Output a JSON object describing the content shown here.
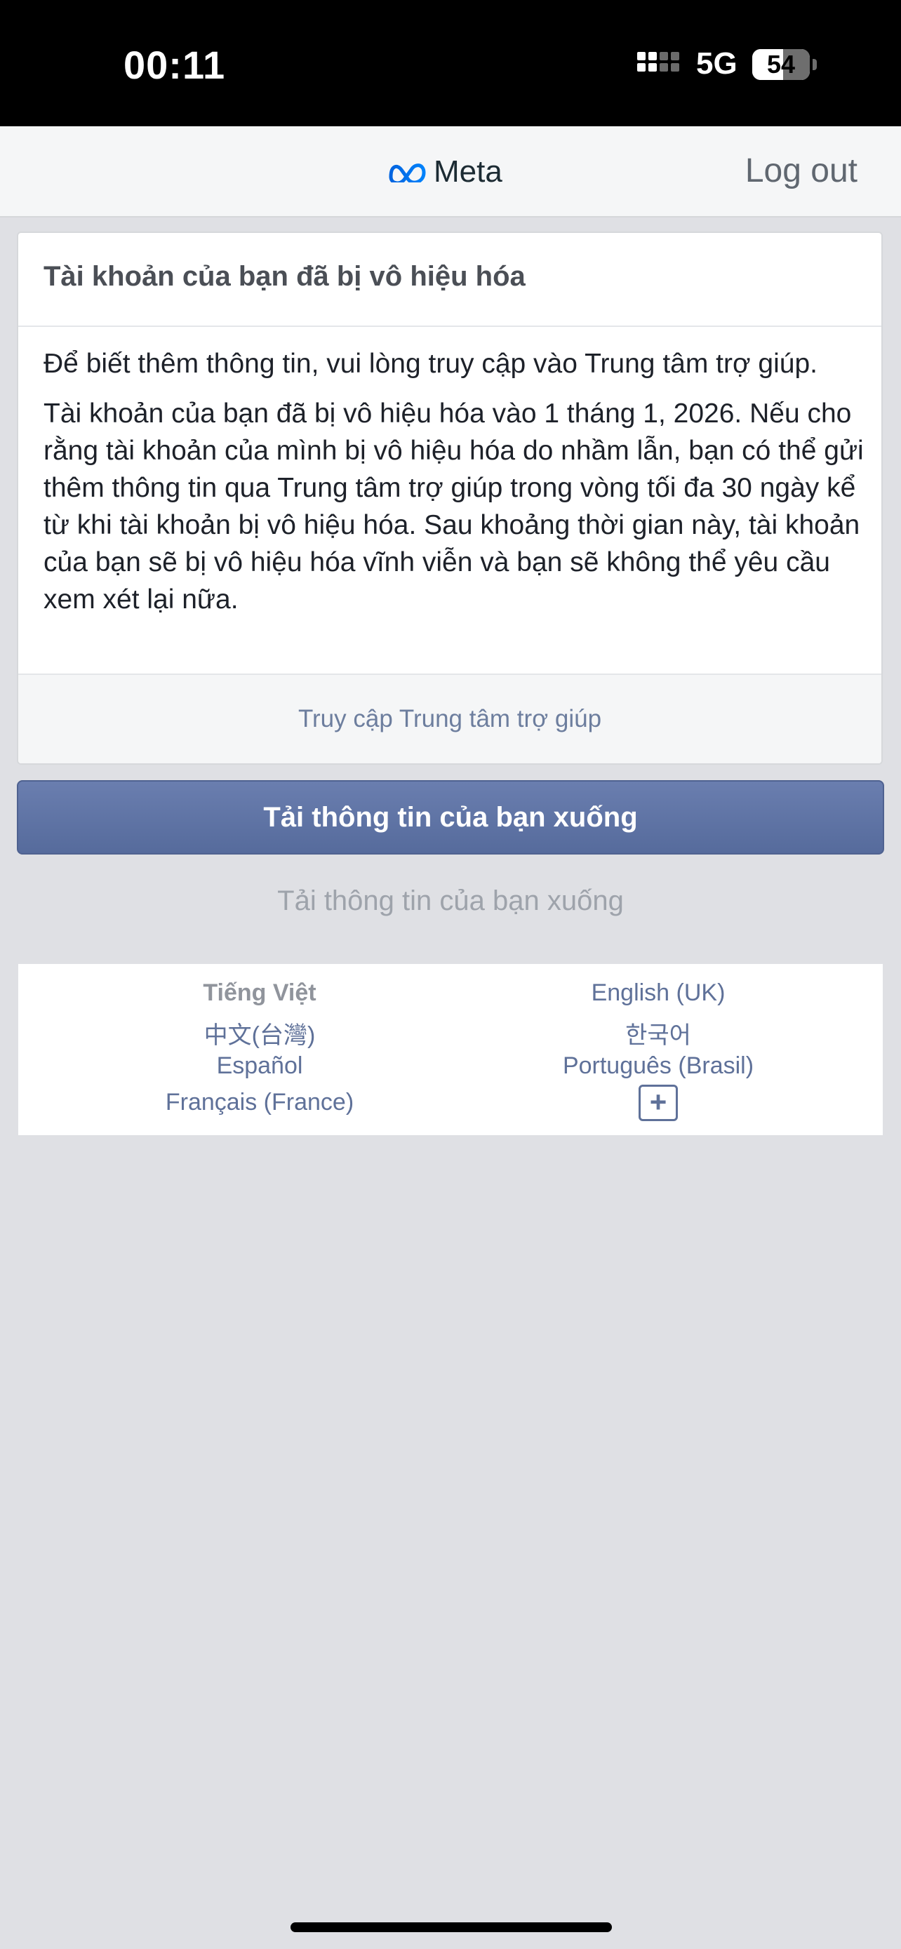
{
  "status_bar": {
    "time": "00:11",
    "network": "5G",
    "battery": "54",
    "battery_level": 0.54
  },
  "navbar": {
    "brand": "Meta",
    "logout_label": "Log out"
  },
  "notice": {
    "title": "Tài khoản của bạn đã bị vô hiệu hóa",
    "paragraph1": "Để biết thêm thông tin, vui lòng truy cập vào Trung tâm trợ giúp.",
    "paragraph2": "Tài khoản của bạn đã bị vô hiệu hóa vào 1 tháng 1, 2026. Nếu cho rằng tài khoản của mình bị vô hiệu hóa do nhầm lẫn, bạn có thể gửi thêm thông tin qua Trung tâm trợ giúp trong vòng tối đa 30 ngày kể từ khi tài khoản bị vô hiệu hóa. Sau khoảng thời gian này, tài khoản của bạn sẽ bị vô hiệu hóa vĩnh viễn và bạn sẽ không thể yêu cầu xem xét lại nữa.",
    "help_link": "Truy cập Trung tâm trợ giúp"
  },
  "actions": {
    "download_button": "Tải thông tin của bạn xuống",
    "download_link": "Tải thông tin của bạn xuống"
  },
  "languages": {
    "items": [
      "Tiếng Việt",
      "English (UK)",
      "中文(台灣)",
      "한국어",
      "Español",
      "Português (Brasil)",
      "Français (France)"
    ],
    "more": "+"
  },
  "colors": {
    "accent": "#5f7199",
    "button": "#5f73a5",
    "background": "#dfe0e4"
  }
}
